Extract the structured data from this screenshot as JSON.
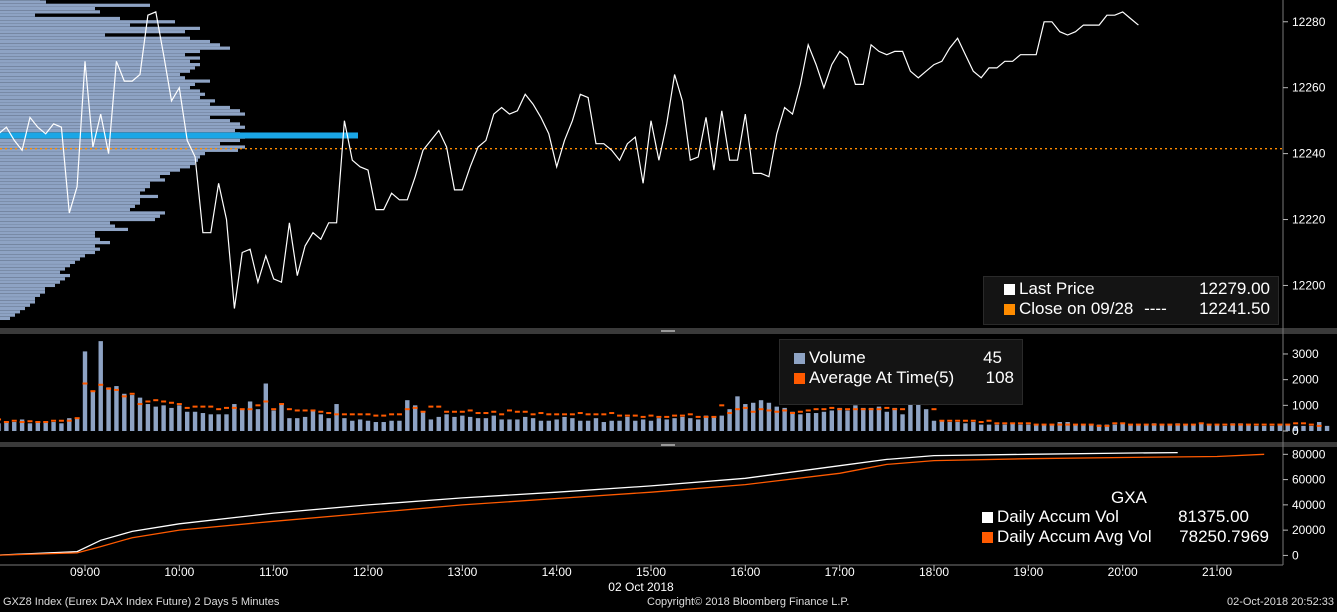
{
  "footer": {
    "security": "GXZ8 Index (Eurex DAX Index Future) 2 Days 5 Minutes",
    "copyright": "Copyright© 2018 Bloomberg Finance L.P.",
    "timestamp": "02-Oct-2018 20:52:33"
  },
  "legends": {
    "price": {
      "last_label": "Last Price",
      "last_value": "12279.00",
      "close_label": "Close on 09/28",
      "close_dash": "----",
      "close_value": "12241.50"
    },
    "volume": {
      "volume_label": "Volume",
      "volume_value": "45",
      "avg_label": "Average At Time(5)",
      "avg_value": "108"
    },
    "accum": {
      "title": "GXA",
      "vol_label": "Daily Accum Vol",
      "vol_value": "81375.00",
      "avg_label": "Daily Accum Avg Vol",
      "avg_value": "78250.7969"
    }
  },
  "colors": {
    "background": "#000000",
    "price_line": "#ffffff",
    "close_line": "#ff8c00",
    "volume_bar": "#8ea3c4",
    "average": "#ff5a00",
    "profile": "#8ea3c4",
    "poc": "#1aa6e6"
  },
  "chart_data": [
    {
      "type": "line",
      "panel": "price",
      "x_ticks": [
        "09:00",
        "10:00",
        "11:00",
        "12:00",
        "13:00",
        "14:00",
        "15:00",
        "16:00",
        "17:00",
        "18:00",
        "19:00",
        "20:00",
        "21:00"
      ],
      "x_date_label": "02 Oct 2018",
      "y_ticks": [
        12200,
        12220,
        12240,
        12260,
        12280
      ],
      "ylim": [
        12188,
        12286
      ],
      "close_level": 12241.5,
      "series": [
        {
          "name": "Last Price",
          "x_start": "08:00",
          "step_minutes": 5,
          "values": [
            12242,
            12246,
            12248,
            12244,
            12241,
            12251,
            12248,
            12246,
            12249,
            12248,
            12222,
            12230,
            12268,
            12242,
            12252,
            12240,
            12268,
            12262,
            12262,
            12264,
            12282,
            12283,
            12270,
            12256,
            12260,
            12244,
            12239,
            12216,
            12216,
            12231,
            12220,
            12193,
            12210,
            12211,
            12201,
            12209,
            12202,
            12201,
            12219,
            12203,
            12212,
            12216,
            12214,
            12219,
            12219,
            12250,
            12238,
            12236,
            12235,
            12223,
            12223,
            12228,
            12226,
            12226,
            12233,
            12241,
            12244,
            12247,
            12242,
            12229,
            12229,
            12236,
            12242,
            12244,
            12252,
            12254,
            12252,
            12253,
            12258,
            12255,
            12251,
            12246,
            12236,
            12244,
            12250,
            12258,
            12257,
            12243,
            12243,
            12241,
            12238,
            12243,
            12245,
            12231,
            12250,
            12238,
            12249,
            12264,
            12256,
            12238,
            12239,
            12251,
            12235,
            12253,
            12238,
            12238,
            12252,
            12234,
            12234,
            12233,
            12246,
            12254,
            12252,
            12261,
            12273,
            12267,
            12260,
            12267,
            12271,
            12269,
            12261,
            12261,
            12273,
            12271,
            12270,
            12271,
            12271,
            12265,
            12263,
            12265,
            12267,
            12268,
            12272,
            12275,
            12270,
            12265,
            12263,
            12266,
            12266,
            12268,
            12268,
            12270,
            12270,
            12270,
            12280,
            12280,
            12277,
            12276,
            12277,
            12279,
            12279,
            12279,
            12282,
            12282,
            12283,
            12281,
            12279
          ]
        }
      ],
      "volume_profile": {
        "poc_price": 12245.5,
        "prices": [
          12287,
          12286,
          12285,
          12284,
          12283,
          12282,
          12281,
          12280,
          12279,
          12278,
          12277,
          12276,
          12275,
          12274,
          12273,
          12272,
          12271,
          12270,
          12269,
          12268,
          12267,
          12266,
          12265,
          12264,
          12263,
          12262,
          12261,
          12260,
          12259,
          12258,
          12257,
          12256,
          12255,
          12254,
          12253,
          12252,
          12251,
          12250,
          12249,
          12248,
          12247,
          12246,
          12245,
          12244,
          12243,
          12242,
          12241,
          12240,
          12239,
          12238,
          12237,
          12236,
          12235,
          12234,
          12233,
          12232,
          12231,
          12230,
          12229,
          12228,
          12227,
          12226,
          12225,
          12224,
          12223,
          12222,
          12221,
          12220,
          12219,
          12218,
          12217,
          12216,
          12215,
          12214,
          12213,
          12212,
          12211,
          12210,
          12209,
          12208,
          12207,
          12206,
          12205,
          12204,
          12203,
          12202,
          12201,
          12200,
          12199,
          12198,
          12197,
          12196,
          12195,
          12194,
          12193,
          12192,
          12191,
          12190
        ],
        "lengths": [
          40,
          46,
          150,
          95,
          100,
          35,
          120,
          175,
          130,
          200,
          185,
          105,
          190,
          210,
          220,
          230,
          200,
          185,
          200,
          190,
          200,
          195,
          190,
          180,
          185,
          210,
          195,
          190,
          200,
          205,
          200,
          215,
          210,
          230,
          240,
          245,
          210,
          230,
          240,
          245,
          235,
          240,
          245,
          240,
          220,
          245,
          238,
          205,
          200,
          198,
          195,
          190,
          180,
          170,
          160,
          165,
          150,
          150,
          145,
          140,
          158,
          140,
          140,
          135,
          130,
          165,
          160,
          155,
          110,
          115,
          128,
          95,
          95,
          100,
          110,
          95,
          100,
          95,
          85,
          80,
          75,
          70,
          65,
          60,
          70,
          65,
          60,
          55,
          45,
          45,
          40,
          35,
          35,
          30,
          25,
          20,
          15,
          10
        ]
      }
    },
    {
      "type": "bar",
      "panel": "volume",
      "y_ticks": [
        0,
        1000,
        2000,
        3000
      ],
      "ylim": [
        -350,
        3700
      ],
      "series": [
        {
          "name": "Volume",
          "values": [
            700,
            300,
            350,
            350,
            450,
            300,
            350,
            350,
            350,
            300,
            500,
            500,
            3100,
            1550,
            3500,
            1700,
            1750,
            1450,
            1400,
            1300,
            1050,
            950,
            1000,
            900,
            1000,
            750,
            750,
            700,
            650,
            650,
            650,
            1050,
            850,
            1150,
            850,
            1850,
            800,
            1050,
            500,
            500,
            550,
            800,
            650,
            500,
            1050,
            500,
            400,
            450,
            400,
            350,
            350,
            400,
            400,
            1200,
            1000,
            750,
            450,
            550,
            650,
            550,
            600,
            550,
            500,
            500,
            600,
            450,
            450,
            450,
            550,
            500,
            400,
            400,
            450,
            550,
            500,
            400,
            400,
            500,
            350,
            400,
            400,
            550,
            400,
            450,
            400,
            500,
            450,
            500,
            550,
            500,
            450,
            600,
            550,
            600,
            850,
            1350,
            1050,
            1100,
            1200,
            1100,
            950,
            900,
            750,
            650,
            700,
            700,
            750,
            800,
            900,
            800,
            1000,
            900,
            900,
            950,
            750,
            900,
            650,
            1300,
            1150,
            850,
            400,
            400,
            350,
            350,
            300,
            350,
            250,
            250,
            250,
            250,
            300,
            250,
            250,
            250,
            250,
            250,
            350,
            350,
            250,
            250,
            250,
            250,
            250,
            250,
            300,
            250,
            250,
            250,
            300,
            250,
            250,
            300,
            250,
            250,
            300,
            250,
            250,
            200,
            300,
            300,
            250,
            200,
            200,
            200,
            250,
            250,
            200,
            200,
            200,
            350,
            200
          ]
        },
        {
          "name": "Average At Time(5)",
          "values": [
            450,
            450,
            350,
            400,
            350,
            380,
            350,
            350,
            400,
            400,
            400,
            500,
            1850,
            1550,
            1800,
            1650,
            1600,
            1350,
            1450,
            1050,
            1150,
            1200,
            1150,
            1100,
            1050,
            900,
            950,
            950,
            950,
            850,
            900,
            900,
            850,
            850,
            1000,
            1150,
            850,
            1050,
            850,
            800,
            800,
            800,
            750,
            700,
            650,
            650,
            650,
            650,
            650,
            600,
            600,
            650,
            650,
            850,
            900,
            750,
            950,
            950,
            750,
            750,
            750,
            800,
            700,
            700,
            750,
            650,
            800,
            750,
            750,
            650,
            700,
            650,
            650,
            650,
            650,
            700,
            650,
            650,
            650,
            700,
            600,
            600,
            600,
            550,
            600,
            550,
            550,
            600,
            600,
            650,
            550,
            550,
            550,
            1000,
            700,
            850,
            900,
            750,
            850,
            800,
            750,
            800,
            700,
            750,
            800,
            850,
            850,
            900,
            850,
            850,
            850,
            850,
            850,
            850,
            900,
            850,
            850,
            1300,
            1450,
            1050,
            850,
            400,
            400,
            400,
            400,
            400,
            350,
            400,
            300,
            300,
            300,
            300,
            300,
            250,
            250,
            250,
            250,
            250,
            250,
            250,
            250,
            200,
            200,
            300,
            300,
            250,
            250,
            250,
            250,
            250,
            250,
            250,
            250,
            250,
            300,
            250,
            250,
            250,
            250,
            250,
            250,
            250,
            250,
            250,
            250,
            250,
            300,
            300,
            250,
            200
          ]
        }
      ]
    },
    {
      "type": "line",
      "panel": "accum",
      "y_ticks": [
        0,
        20000,
        40000,
        60000,
        80000
      ],
      "ylim": [
        -6000,
        85000
      ],
      "series": [
        {
          "name": "Daily Accum Vol",
          "x": [
            "08:00",
            "08:55",
            "09:10",
            "09:30",
            "10:00",
            "11:00",
            "12:00",
            "13:00",
            "14:00",
            "15:00",
            "16:00",
            "17:00",
            "17:30",
            "18:00",
            "19:00",
            "20:00",
            "20:35"
          ],
          "values": [
            0,
            3000,
            12000,
            19000,
            25000,
            33500,
            40000,
            45500,
            50000,
            55000,
            61000,
            71000,
            76000,
            79000,
            80000,
            81000,
            81375
          ]
        },
        {
          "name": "Daily Accum Avg Vol",
          "x": [
            "08:00",
            "08:55",
            "09:10",
            "09:30",
            "10:00",
            "11:00",
            "12:00",
            "13:00",
            "14:00",
            "15:00",
            "16:00",
            "17:00",
            "17:30",
            "18:00",
            "19:00",
            "20:00",
            "21:00",
            "21:30"
          ],
          "values": [
            0,
            2000,
            7000,
            14000,
            20000,
            27000,
            33500,
            40000,
            45000,
            50000,
            56000,
            65000,
            72000,
            75000,
            76500,
            77500,
            78250,
            80000
          ]
        }
      ]
    }
  ]
}
